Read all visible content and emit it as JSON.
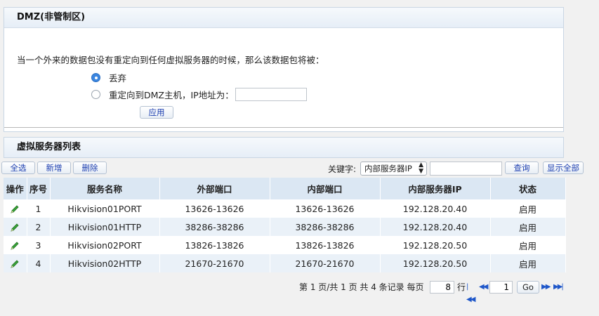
{
  "dmz": {
    "title": "DMZ(非管制区)",
    "question": "当一个外来的数据包没有重定向到任何虚拟服务器的时候，那么该数据包将被：",
    "option_drop": "丢弃",
    "option_redirect": "重定向到DMZ主机，IP地址为：",
    "ip_value": "",
    "apply_label": "应用",
    "selected": "drop"
  },
  "virtual_server": {
    "title": "虚拟服务器列表",
    "toolbar": {
      "select_all": "全选",
      "add": "新增",
      "delete": "删除",
      "keyword_label": "关键字:",
      "keyword_select": "内部服务器IP",
      "keyword_value": "",
      "search": "查询",
      "show_all": "显示全部"
    },
    "columns": [
      "操作",
      "序号",
      "服务名称",
      "外部端口",
      "内部端口",
      "内部服务器IP",
      "状态"
    ],
    "rows": [
      {
        "index": "1",
        "name": "Hikvision01PORT",
        "ext_port": "13626-13626",
        "int_port": "13626-13626",
        "ip": "192.128.20.40",
        "status": "启用"
      },
      {
        "index": "2",
        "name": "Hikvision01HTTP",
        "ext_port": "38286-38286",
        "int_port": "38286-38286",
        "ip": "192.128.20.40",
        "status": "启用"
      },
      {
        "index": "3",
        "name": "Hikvision02PORT",
        "ext_port": "13826-13826",
        "int_port": "13826-13826",
        "ip": "192.128.20.50",
        "status": "启用"
      },
      {
        "index": "4",
        "name": "Hikvision02HTTP",
        "ext_port": "21670-21670",
        "int_port": "21670-21670",
        "ip": "192.128.20.50",
        "status": "启用"
      }
    ],
    "edit_icon": "pencil-icon"
  },
  "pager": {
    "summary": "第 1 页/共 1 页 共 4 条记录 每页",
    "per_page": "8",
    "row_unit": "行",
    "page_value": "1",
    "go_label": "Go"
  },
  "colors": {
    "header_bg": "#dbe7f3",
    "row_alt_bg": "#eaf1f8",
    "link_blue": "#1d3fb0",
    "radio_blue": "#3b86e0",
    "edit_green": "#2e9a2e"
  }
}
